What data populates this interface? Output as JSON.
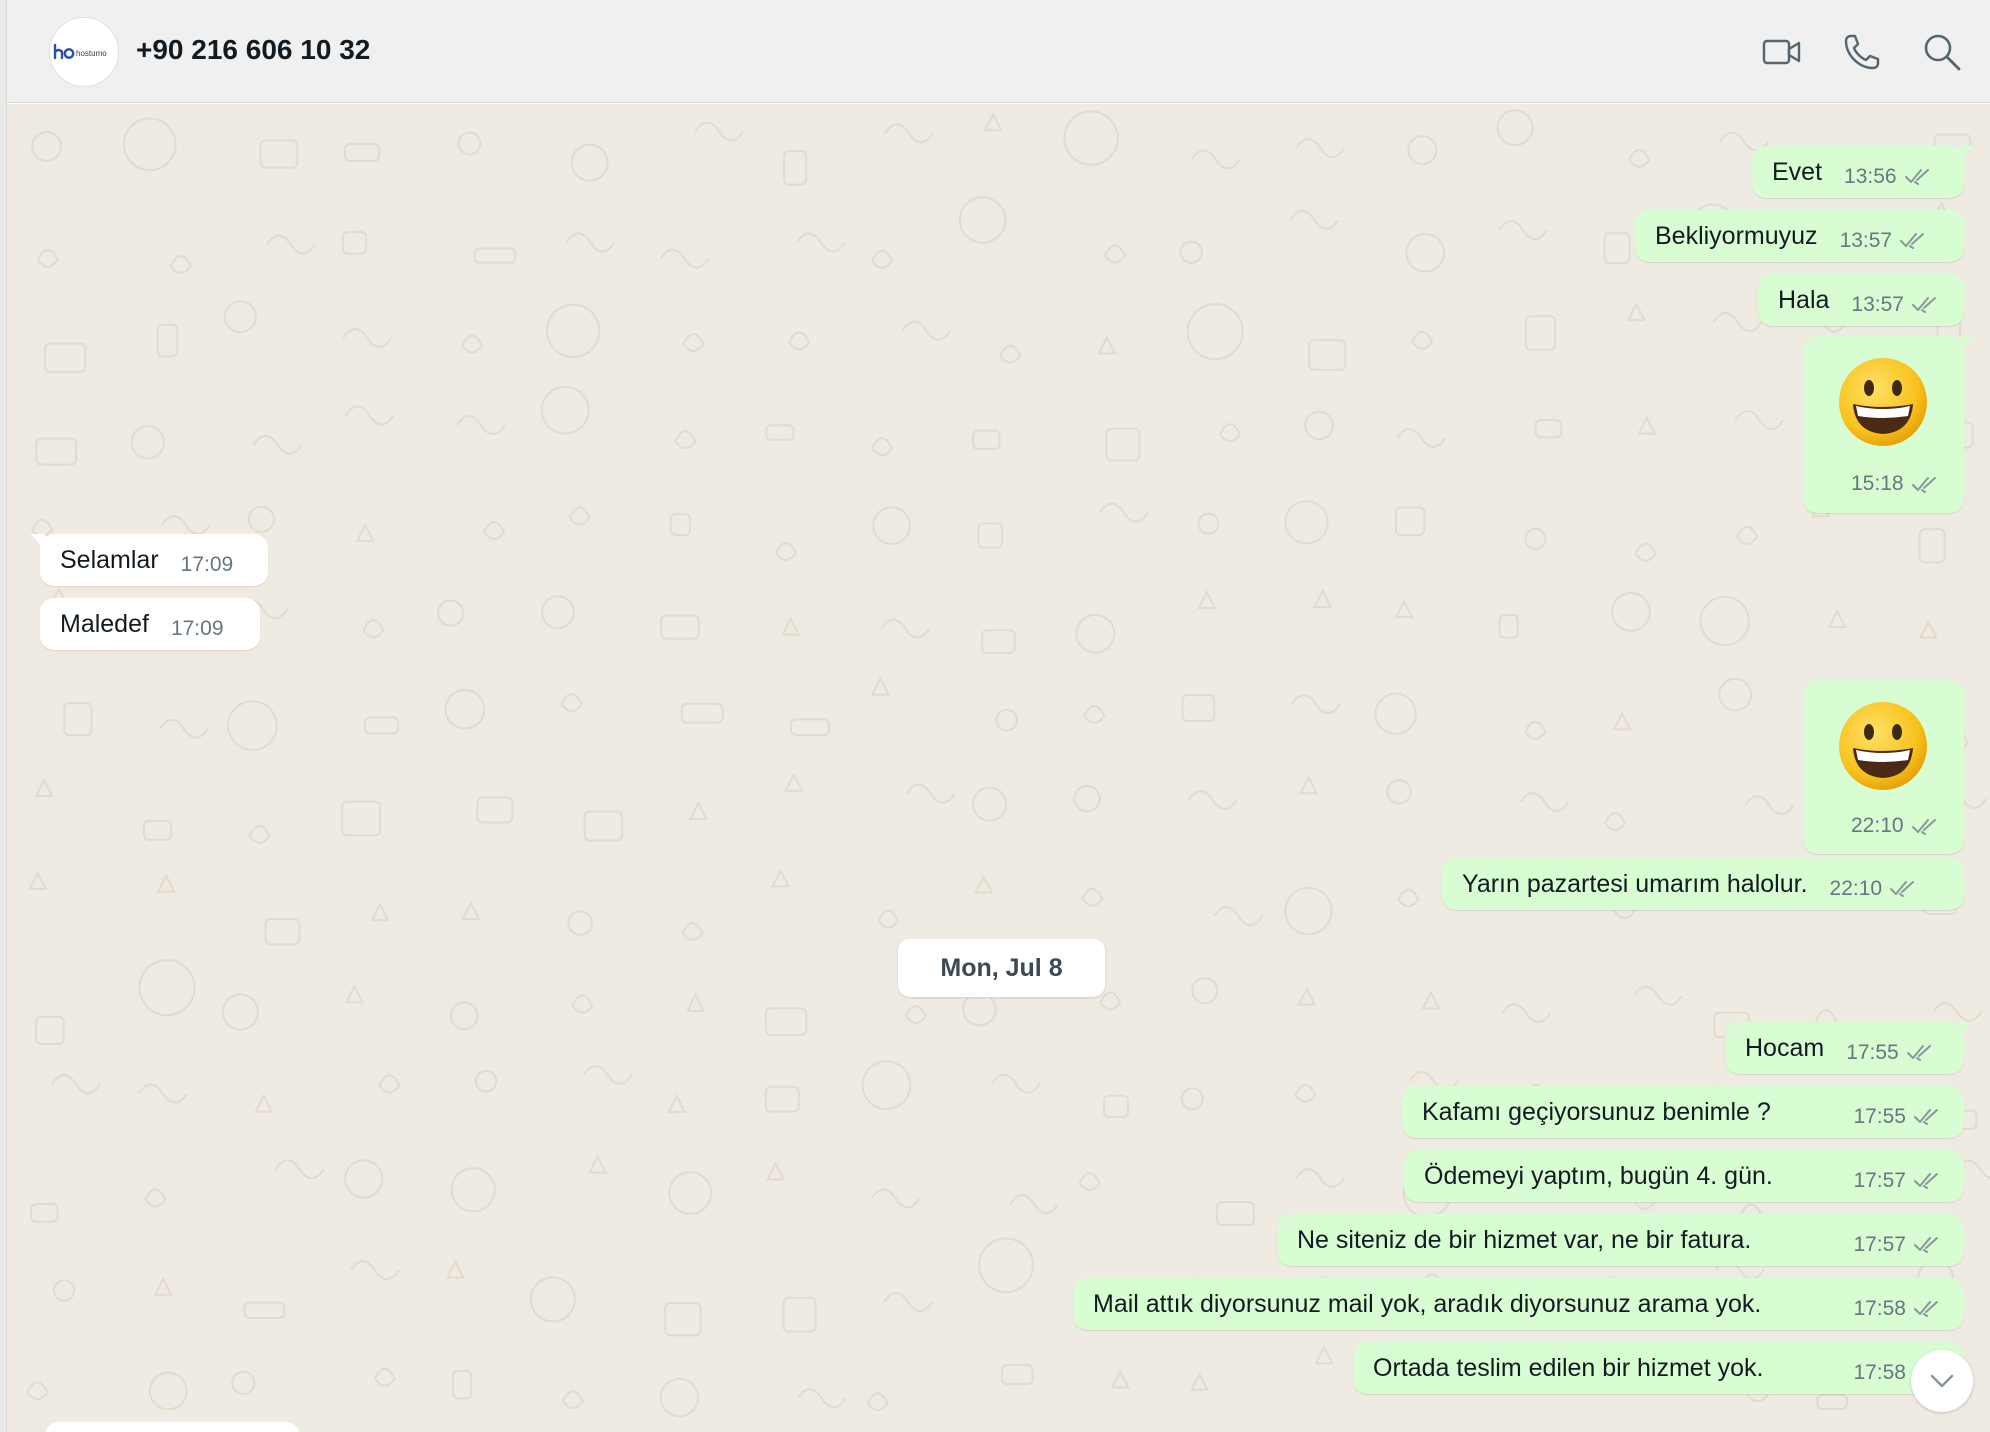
{
  "header": {
    "contact_name": "+90 216 606 10 32",
    "avatar_logo_text": "hostumo",
    "icons": [
      "video-call-icon",
      "voice-call-icon",
      "search-icon"
    ]
  },
  "colors": {
    "outgoing_bubble": "#d9fdd3",
    "incoming_bubble": "#ffffff",
    "chat_background": "#efeae2",
    "header_background": "#f0f0f0",
    "read_ticks": "#8a969c"
  },
  "messages": [
    {
      "direction": "out",
      "text": "Evet",
      "time": "13:56",
      "status": "read"
    },
    {
      "direction": "out",
      "text": "Bekliyormuyuz",
      "time": "13:57",
      "status": "read"
    },
    {
      "direction": "out",
      "text": "Hala",
      "time": "13:57",
      "status": "read"
    },
    {
      "direction": "out",
      "emoji": "grinning-face",
      "time": "15:18",
      "status": "read"
    },
    {
      "direction": "in",
      "text": "Selamlar",
      "time": "17:09"
    },
    {
      "direction": "in",
      "text": "Maledef",
      "time": "17:09"
    },
    {
      "direction": "out",
      "emoji": "grinning-face",
      "time": "22:10",
      "status": "read"
    },
    {
      "direction": "out",
      "text": "Yarın pazartesi umarım halolur.",
      "time": "22:10",
      "status": "read"
    },
    {
      "direction": "out",
      "text": "Hocam",
      "time": "17:55",
      "status": "read"
    },
    {
      "direction": "out",
      "text": "Kafamı geçiyorsunuz benimle ?",
      "time": "17:55",
      "status": "read"
    },
    {
      "direction": "out",
      "text": "Ödemeyi yaptım, bugün 4. gün.",
      "time": "17:57",
      "status": "read"
    },
    {
      "direction": "out",
      "text": "Ne siteniz de bir hizmet var, ne bir fatura.",
      "time": "17:57",
      "status": "read"
    },
    {
      "direction": "out",
      "text": "Mail attık diyorsunuz mail yok, aradık diyorsunuz arama yok.",
      "time": "17:58",
      "status": "read"
    },
    {
      "direction": "out",
      "text": "Ortada teslim edilen bir hizmet yok.",
      "time": "17:58",
      "status": "read"
    }
  ],
  "date_separator": "Mon, Jul 8",
  "scroll_down_icon": "chevron-down-icon"
}
